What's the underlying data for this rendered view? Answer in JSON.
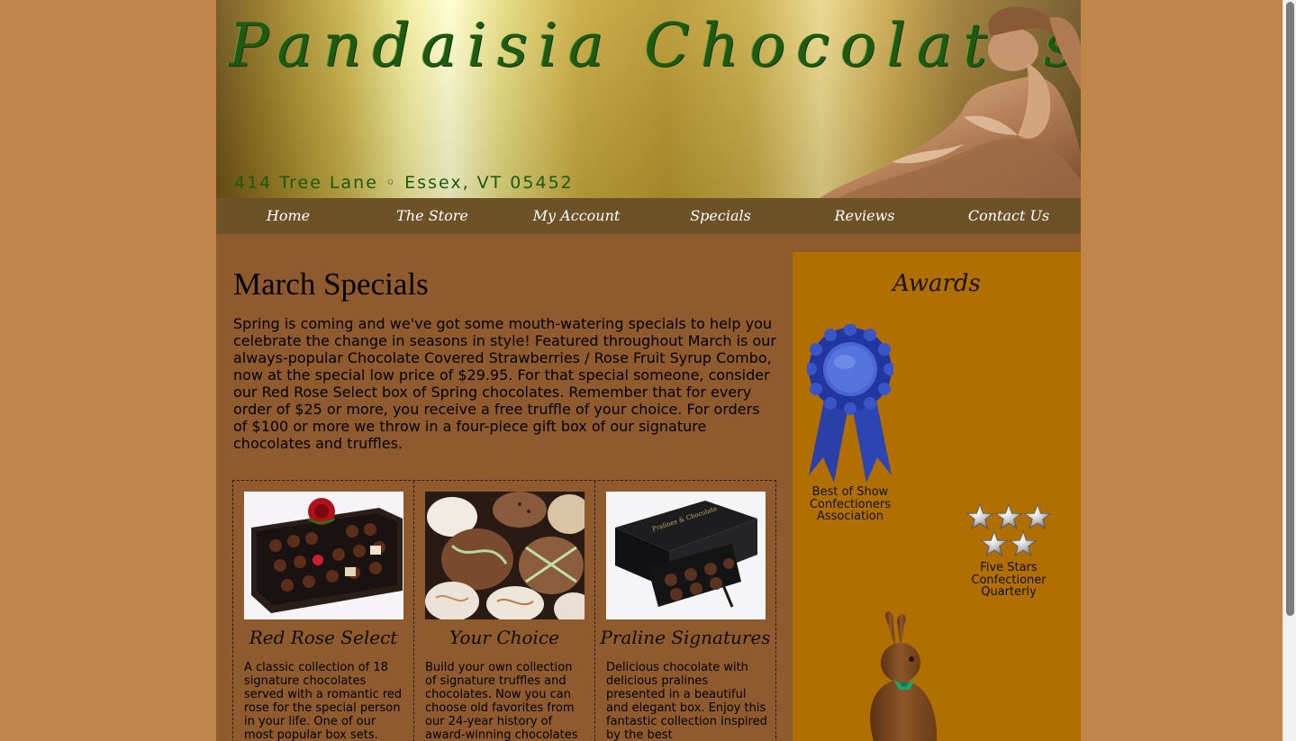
{
  "header": {
    "logo": "Pandaisia Chocolates",
    "address": "414 Tree Lane ◦ Essex, VT 05452"
  },
  "nav": {
    "items": [
      "Home",
      "The Store",
      "My Account",
      "Specials",
      "Reviews",
      "Contact Us"
    ]
  },
  "main": {
    "title": "March Specials",
    "intro": "Spring is coming and we've got some mouth-watering specials to help you celebrate the change in seasons in style! Featured throughout March is our always-popular Chocolate Covered Strawberries / Rose Fruit Syrup Combo, now at the special low price of $29.95. For that special someone, consider our Red Rose Select box of Spring chocolates. Remember that for every order of $25 or more, you receive a free truffle of your choice. For orders of $100 or more we throw in a four-piece gift box of our signature chocolates and truffles.",
    "products": [
      {
        "name": "Red Rose Select",
        "desc": "A classic collection of 18 signature chocolates served with a romantic red rose for the special person in your life. One of our most popular box sets."
      },
      {
        "name": "Your Choice",
        "desc": "Build your own collection of signature truffles and chocolates. Now you can choose old favorites from our 24-year history of award-winning chocolates"
      },
      {
        "name": "Praline Signatures",
        "desc": "Delicious chocolate with delicious pralines presented in a beautiful and elegant box. Enjoy this fantastic collection inspired by the best"
      }
    ]
  },
  "sidebar": {
    "title": "Awards",
    "awards": [
      {
        "caption_lines": [
          "Best of Show",
          "Confectioners",
          "Association"
        ],
        "icon": "blue-ribbon-icon"
      },
      {
        "caption_lines": [
          "Five Stars",
          "Confectioner",
          "Quarterly"
        ],
        "icon": "five-stars-icon",
        "rating": 5
      }
    ]
  },
  "colors": {
    "page_bg": "#c08549",
    "content_bg": "#8f5a2e",
    "nav_bg": "#6e5227",
    "sidebar_bg": "#b06f00",
    "logo_green": "#1e5a12"
  }
}
